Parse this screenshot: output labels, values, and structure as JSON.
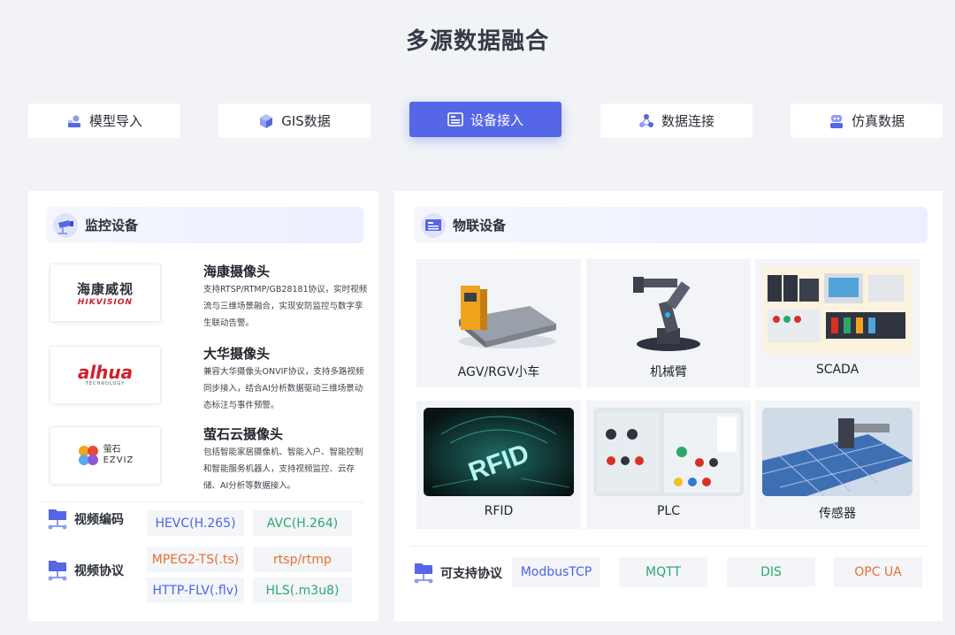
{
  "title": "多源数据融合",
  "tabs": [
    {
      "label": "模型导入",
      "icon": "model-import-icon"
    },
    {
      "label": "GIS数据",
      "icon": "cube-icon"
    },
    {
      "label": "设备接入",
      "icon": "device-icon",
      "active": true
    },
    {
      "label": "数据连接",
      "icon": "network-icon"
    },
    {
      "label": "仿真数据",
      "icon": "robot-icon"
    }
  ],
  "colors": {
    "accent": "#5566e6",
    "blue": "#4b63e6",
    "green": "#2aa86b",
    "orange": "#e8702e"
  },
  "monitor": {
    "title": "监控设备",
    "cameras": [
      {
        "logo_text": "海康威视",
        "logo_sub": "HIKVISION",
        "name": "海康摄像头",
        "desc": "支持RTSP/RTMP/GB28181协议，实时视频流与三维场景融合，实现安防监控与数字孪生联动告警。"
      },
      {
        "logo_text": "alhua",
        "logo_sub": "TECHNOLOGY",
        "name": "大华摄像头",
        "desc": "兼容大华摄像头ONVIF协议，支持多路视频同步接入，结合AI分析数据驱动三维场景动态标注与事件预警。"
      },
      {
        "logo_text": "萤石",
        "logo_sub": "EZVIZ",
        "name": "萤石云摄像头",
        "desc": "包括智能家居摄像机、智能入户、智能控制和智能服务机器人，支持视频监控、云存储、AI分析等数据接入。"
      }
    ],
    "codec": {
      "label": "视频编码",
      "chips": [
        "HEVC(H.265)",
        "AVC(H.264)"
      ]
    },
    "protocol": {
      "label": "视频协议",
      "chips": [
        "MPEG2-TS(.ts)",
        "rtsp/rtmp",
        "HTTP-FLV(.flv)",
        "HLS(.m3u8)"
      ]
    }
  },
  "iot": {
    "title": "物联设备",
    "devices": [
      "AGV/RGV小车",
      "机械臂",
      "SCADA",
      "RFID",
      "PLC",
      "传感器"
    ],
    "rfid_text": "RFID",
    "protocols": {
      "label": "可支持协议",
      "chips": [
        "ModbusTCP",
        "MQTT",
        "DIS",
        "OPC UA"
      ]
    }
  }
}
